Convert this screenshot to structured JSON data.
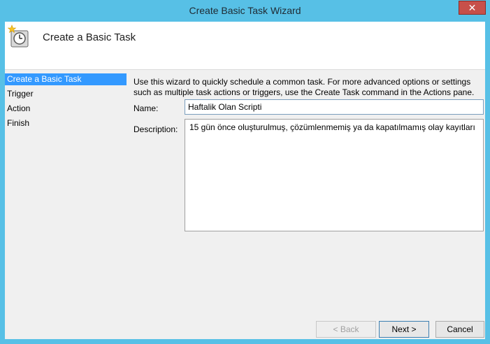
{
  "window": {
    "title": "Create Basic Task Wizard",
    "close_glyph": "✕"
  },
  "header": {
    "icon": "task-scheduler-clock-icon",
    "title": "Create a Basic Task"
  },
  "nav": {
    "items": [
      {
        "label": "Create a Basic Task",
        "selected": true
      },
      {
        "label": "Trigger",
        "selected": false
      },
      {
        "label": "Action",
        "selected": false
      },
      {
        "label": "Finish",
        "selected": false
      }
    ]
  },
  "form": {
    "intro_line1": "Use this wizard to quickly schedule a common task.  For more advanced options or settings",
    "intro_line2": "such as multiple task actions or triggers, use the Create Task command in the Actions pane.",
    "name_label": "Name:",
    "name_value": "Haftalik Olan Scripti",
    "description_label": "Description:",
    "description_value": "15 gün önce oluşturulmuş, çözümlenmemiş ya da kapatılmamış olay kayıtları"
  },
  "buttons": {
    "back": "< Back",
    "next": "Next >",
    "cancel": "Cancel"
  },
  "colors": {
    "titlebar": "#57c0e6",
    "close_button": "#c7504a",
    "selection": "#3399ff"
  }
}
